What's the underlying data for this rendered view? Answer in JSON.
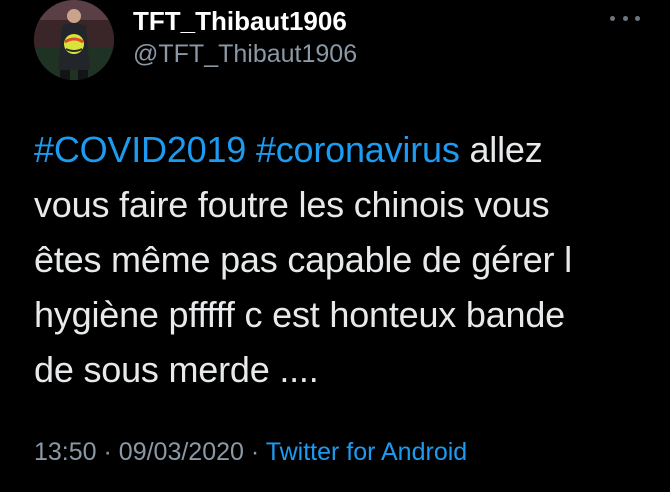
{
  "user": {
    "display_name": "TFT_Thibaut1906",
    "handle": "@TFT_Thibaut1906"
  },
  "menu": {
    "icon": "more-horizontal-icon"
  },
  "tweet": {
    "hashtags": [
      "#COVID2019",
      "#coronavirus"
    ],
    "lines": [
      " allez",
      "vous faire foutre les chinois vous",
      "êtes même pas capable de gérer l",
      "hygiène pfffff c est honteux bande",
      "de sous merde ...."
    ]
  },
  "meta": {
    "time": "13:50",
    "separator": "·",
    "date": "09/03/2020",
    "source": "Twitter for Android"
  },
  "colors": {
    "background": "#000000",
    "link": "#1d9bf0",
    "secondary_text": "#8b98a5"
  }
}
